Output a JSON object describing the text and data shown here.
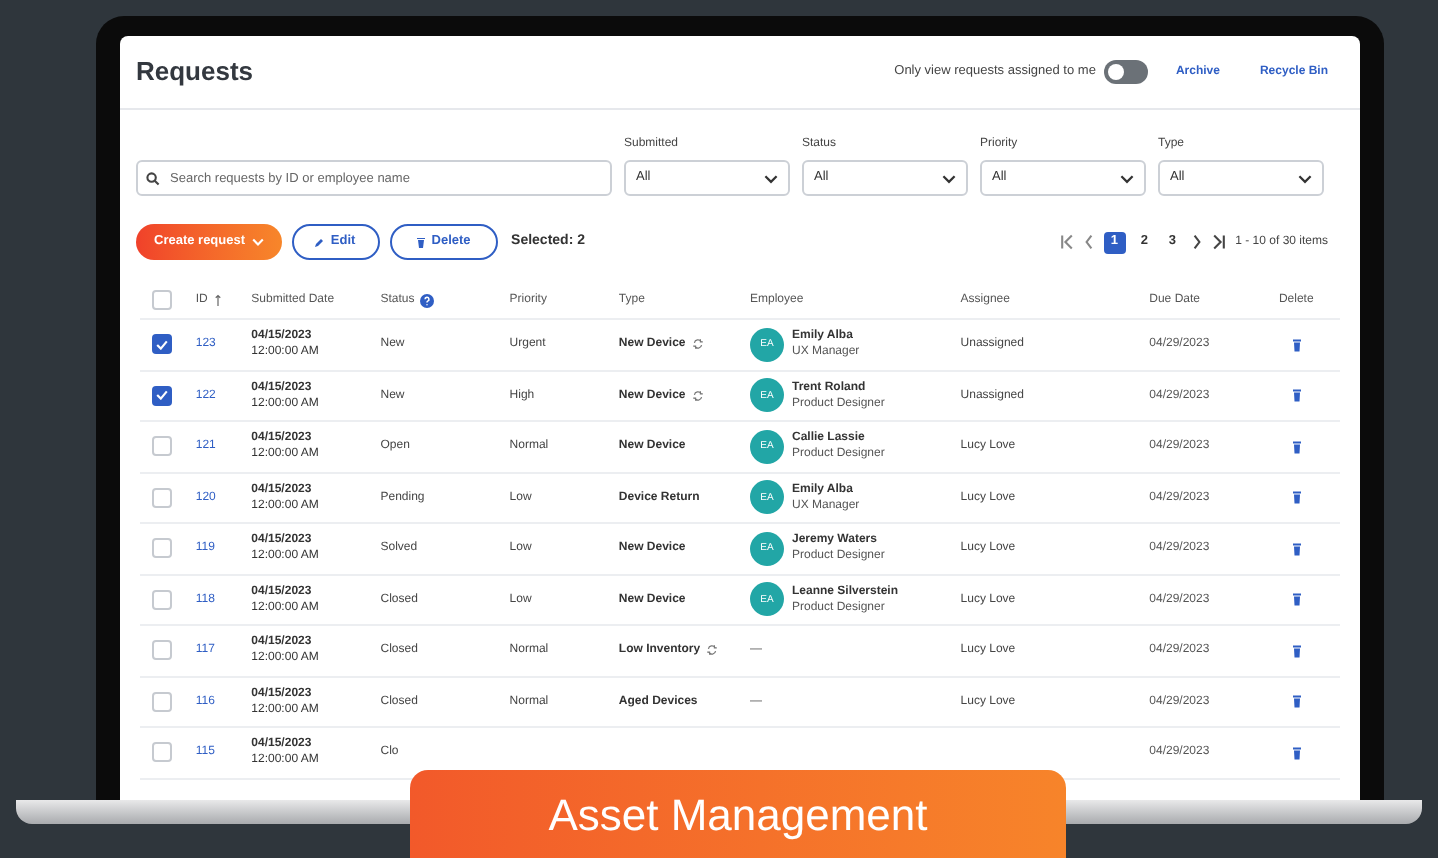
{
  "page_title": "Requests",
  "assigned_toggle": {
    "label": "Only view requests assigned to me",
    "on": false
  },
  "header_links": [
    "Archive",
    "Recycle Bin"
  ],
  "search": {
    "placeholder": "Search requests by ID or employee name"
  },
  "filters": [
    {
      "label": "Submitted",
      "value": "All"
    },
    {
      "label": "Status",
      "value": "All"
    },
    {
      "label": "Priority",
      "value": "All"
    },
    {
      "label": "Type",
      "value": "All"
    }
  ],
  "actions": {
    "create": "Create request",
    "edit": "Edit",
    "delete": "Delete",
    "selected": "Selected: 2"
  },
  "pagination": {
    "pages": [
      {
        "label": "1",
        "selected": true
      },
      {
        "label": "2",
        "selected": false
      },
      {
        "label": "3",
        "selected": false
      }
    ],
    "summary": "1 - 10 of 30 items"
  },
  "table": {
    "select_all_checked": false,
    "columns": [
      "ID",
      "Submitted Date",
      "Status",
      "Priority",
      "Type",
      "Employee",
      "Assignee",
      "Due Date",
      "Delete"
    ],
    "rows": [
      {
        "checked": true,
        "id": "123",
        "date": "04/15/2023",
        "time": "12:00:00 AM",
        "status": "New",
        "priority": "Urgent",
        "type": "New Device",
        "recurring": true,
        "employee": {
          "initials": "EA",
          "name": "Emily Alba",
          "role": "UX Manager"
        },
        "assignee": "Unassigned",
        "due": "04/29/2023"
      },
      {
        "checked": true,
        "id": "122",
        "date": "04/15/2023",
        "time": "12:00:00 AM",
        "status": "New",
        "priority": "High",
        "type": "New Device",
        "recurring": true,
        "employee": {
          "initials": "EA",
          "name": "Trent Roland",
          "role": "Product Designer"
        },
        "assignee": "Unassigned",
        "due": "04/29/2023"
      },
      {
        "checked": false,
        "id": "121",
        "date": "04/15/2023",
        "time": "12:00:00 AM",
        "status": "Open",
        "priority": "Normal",
        "type": "New Device",
        "recurring": false,
        "employee": {
          "initials": "EA",
          "name": "Callie Lassie",
          "role": "Product Designer"
        },
        "assignee": "Lucy Love",
        "due": "04/29/2023"
      },
      {
        "checked": false,
        "id": "120",
        "date": "04/15/2023",
        "time": "12:00:00 AM",
        "status": "Pending",
        "priority": "Low",
        "type": "Device Return",
        "recurring": false,
        "employee": {
          "initials": "EA",
          "name": "Emily Alba",
          "role": "UX Manager"
        },
        "assignee": "Lucy Love",
        "due": "04/29/2023"
      },
      {
        "checked": false,
        "id": "119",
        "date": "04/15/2023",
        "time": "12:00:00 AM",
        "status": "Solved",
        "priority": "Low",
        "type": "New Device",
        "recurring": false,
        "employee": {
          "initials": "EA",
          "name": "Jeremy Waters",
          "role": "Product Designer"
        },
        "assignee": "Lucy Love",
        "due": "04/29/2023"
      },
      {
        "checked": false,
        "id": "118",
        "date": "04/15/2023",
        "time": "12:00:00 AM",
        "status": "Closed",
        "priority": "Low",
        "type": "New Device",
        "recurring": false,
        "employee": {
          "initials": "EA",
          "name": "Leanne Silverstein",
          "role": "Product Designer"
        },
        "assignee": "Lucy Love",
        "due": "04/29/2023"
      },
      {
        "checked": false,
        "id": "117",
        "date": "04/15/2023",
        "time": "12:00:00 AM",
        "status": "Closed",
        "priority": "Normal",
        "type": "Low Inventory",
        "recurring": true,
        "employee": "—",
        "assignee": "Lucy Love",
        "due": "04/29/2023"
      },
      {
        "checked": false,
        "id": "116",
        "date": "04/15/2023",
        "time": "12:00:00 AM",
        "status": "Closed",
        "priority": "Normal",
        "type": "Aged Devices",
        "recurring": false,
        "employee": "—",
        "assignee": "Lucy Love",
        "due": "04/29/2023"
      },
      {
        "checked": false,
        "id": "115",
        "date": "04/15/2023",
        "time": "12:00:00 AM",
        "status": "Clo",
        "due": "04/29/2023"
      }
    ]
  },
  "banner": "Asset Management"
}
